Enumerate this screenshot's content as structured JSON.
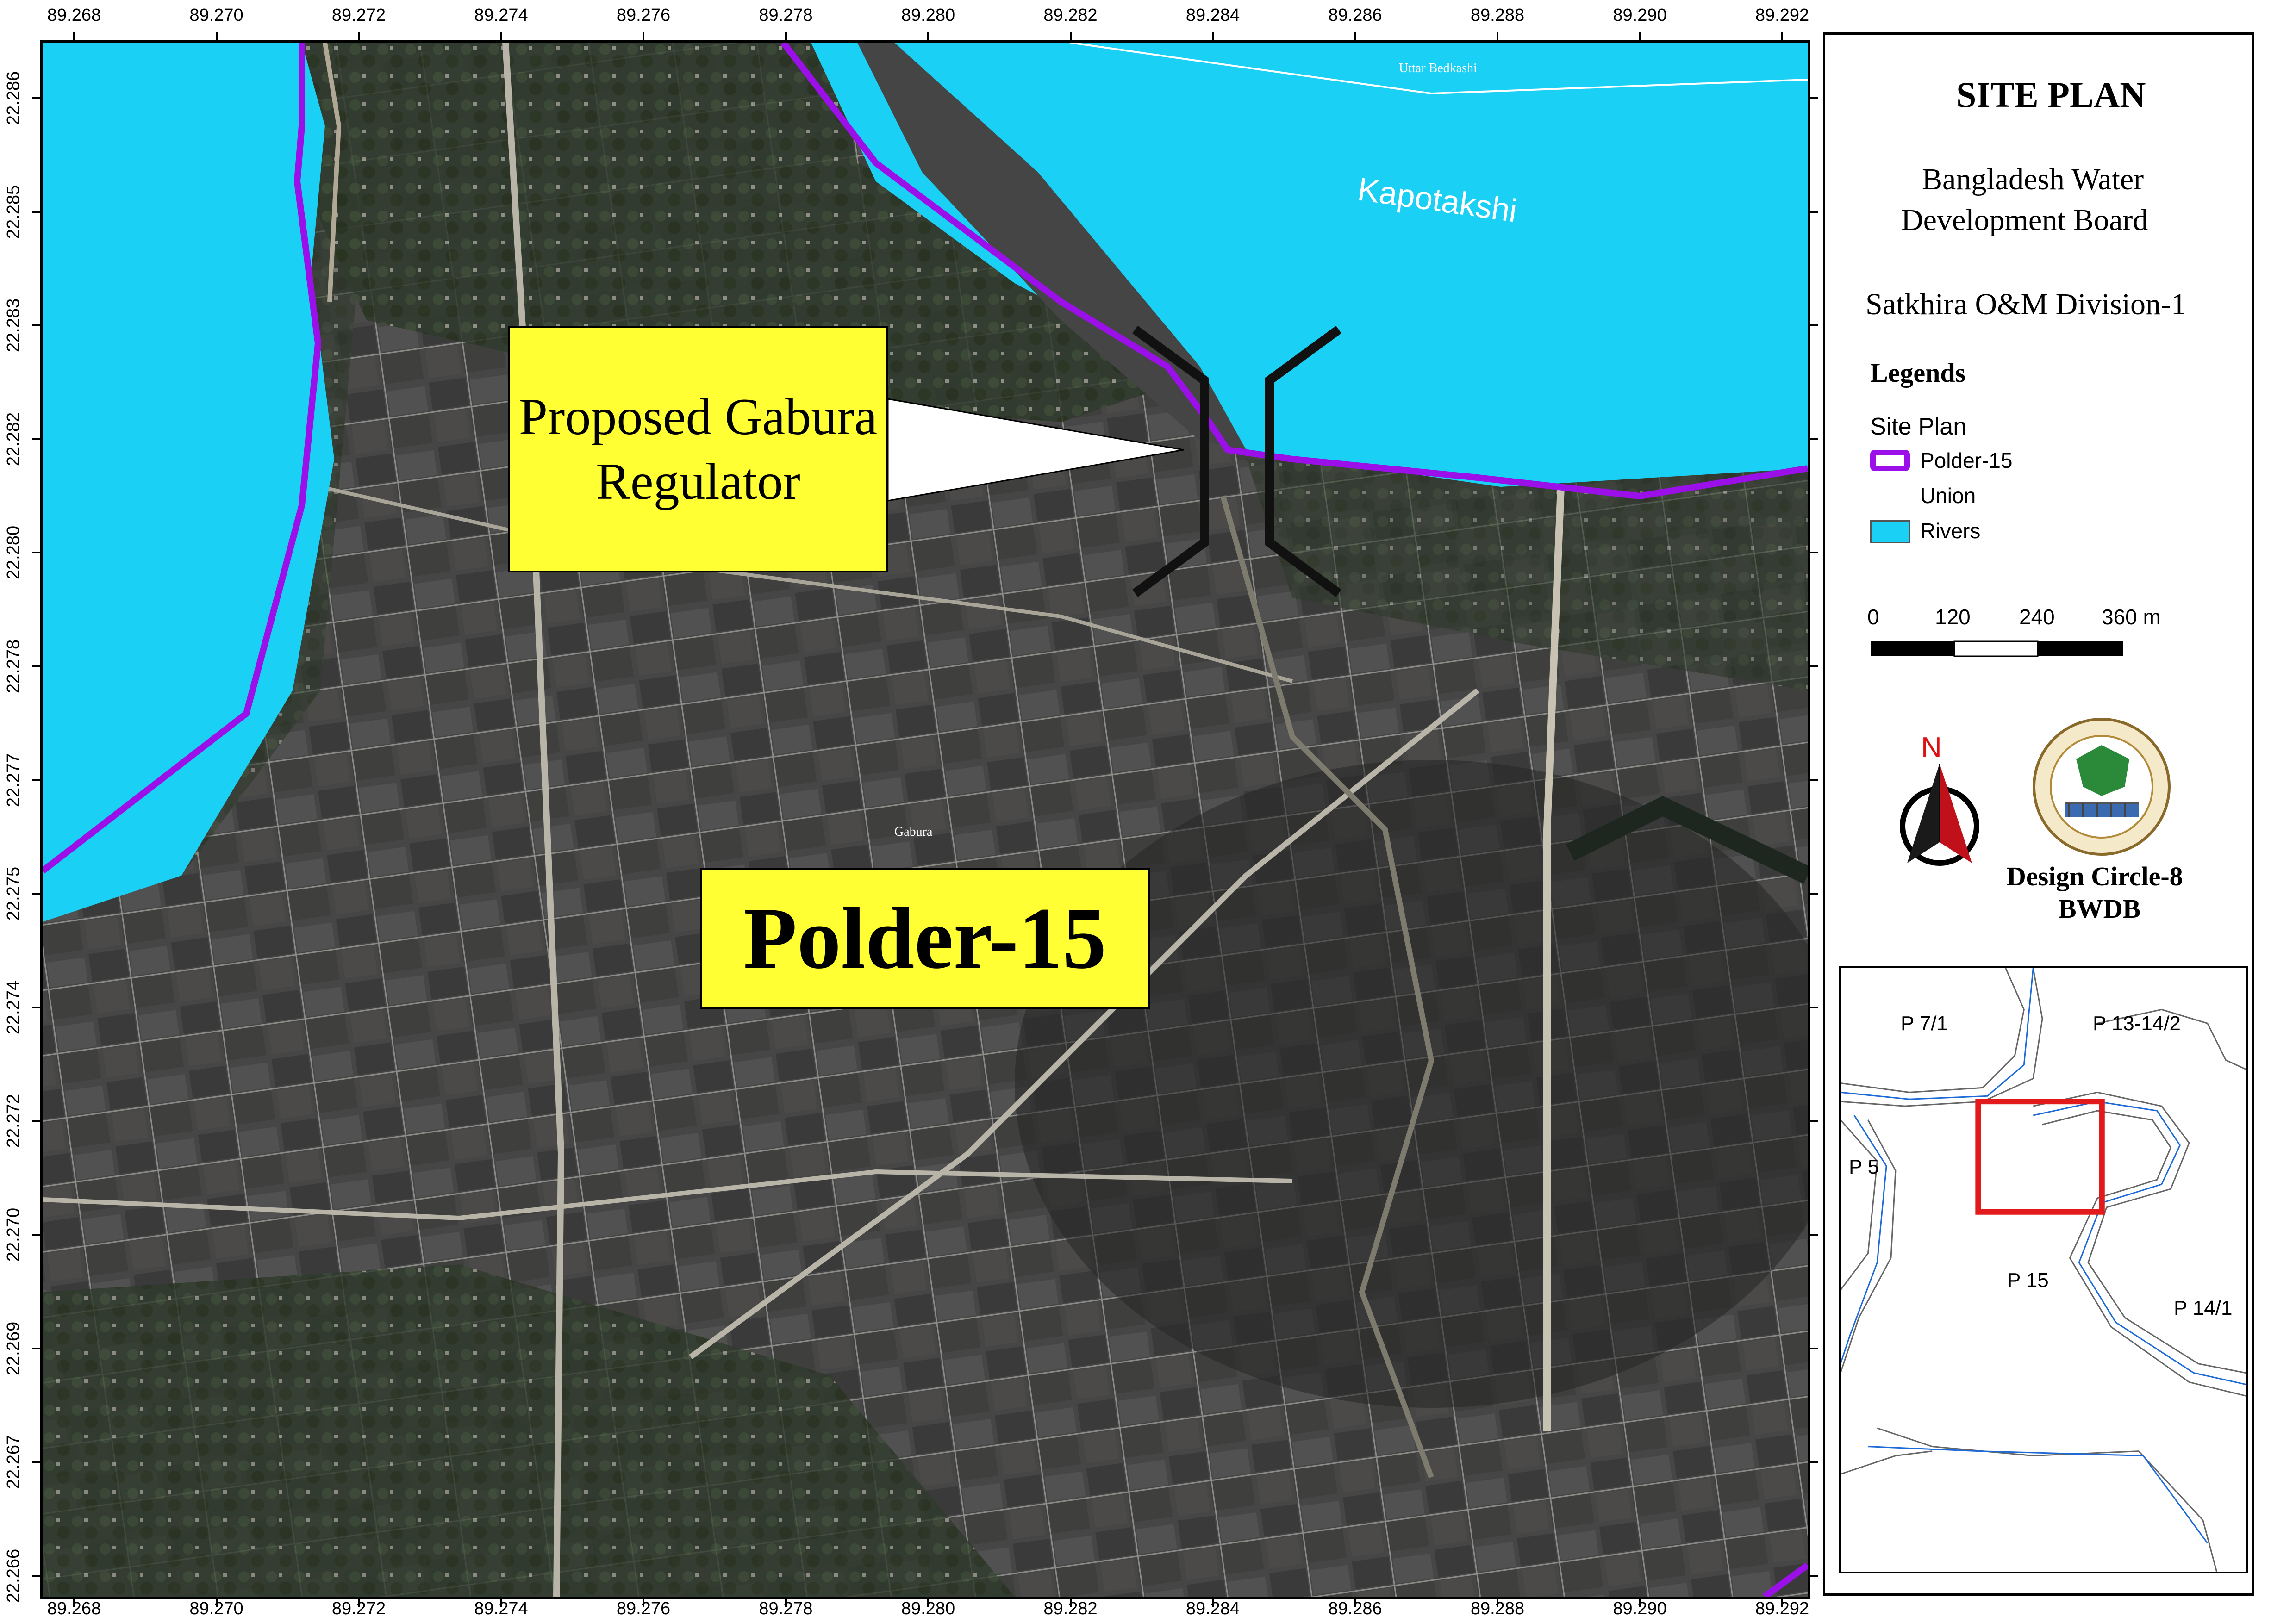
{
  "map": {
    "x_ticks": [
      "89.268",
      "89.270",
      "89.272",
      "89.274",
      "89.276",
      "89.278",
      "89.280",
      "89.282",
      "89.284",
      "89.286",
      "89.288",
      "89.290",
      "89.292"
    ],
    "y_ticks": [
      "22.286",
      "22.285",
      "22.283",
      "22.282",
      "22.280",
      "22.278",
      "22.277",
      "22.275",
      "22.274",
      "22.272",
      "22.270",
      "22.269",
      "22.267",
      "22.266"
    ],
    "river_label": "Kapotakshi",
    "place_uttar": "Uttar Bedkashi",
    "place_gabura": "Gabura",
    "callout_line1": "Proposed Gabura",
    "callout_line2": "Regulator",
    "polder_label": "Polder-15",
    "colors": {
      "river": "#1ad1f5",
      "polder_line": "#9b10e8",
      "callout_fill": "#ffff33",
      "land": "#3d3d3d"
    }
  },
  "panel": {
    "title": "SITE PLAN",
    "org_line1": "Bangladesh Water",
    "org_line2": "Development Board",
    "division": "Satkhira O&M Division-1",
    "legends_title": "Legends",
    "legend_group": "Site Plan",
    "legend_items": [
      {
        "label": "Polder-15",
        "symbol": "polder-line-swatch",
        "color": "#9b10e8"
      },
      {
        "label": "Union",
        "symbol": "none"
      },
      {
        "label": "Rivers",
        "symbol": "river-fill-swatch",
        "color": "#1ad1f5"
      }
    ],
    "scale_labels": [
      "0",
      "120",
      "240",
      "360 m"
    ],
    "north_label": "N",
    "logo_icon": "bwdb-logo-icon",
    "designer_line1": "Design Circle-8",
    "designer_line2": "BWDB"
  },
  "inset": {
    "labels": [
      "P 7/1",
      "P 13-14/2",
      "P 5",
      "P 15",
      "P 14/1"
    ],
    "highlight_color": "#e31a1c"
  }
}
